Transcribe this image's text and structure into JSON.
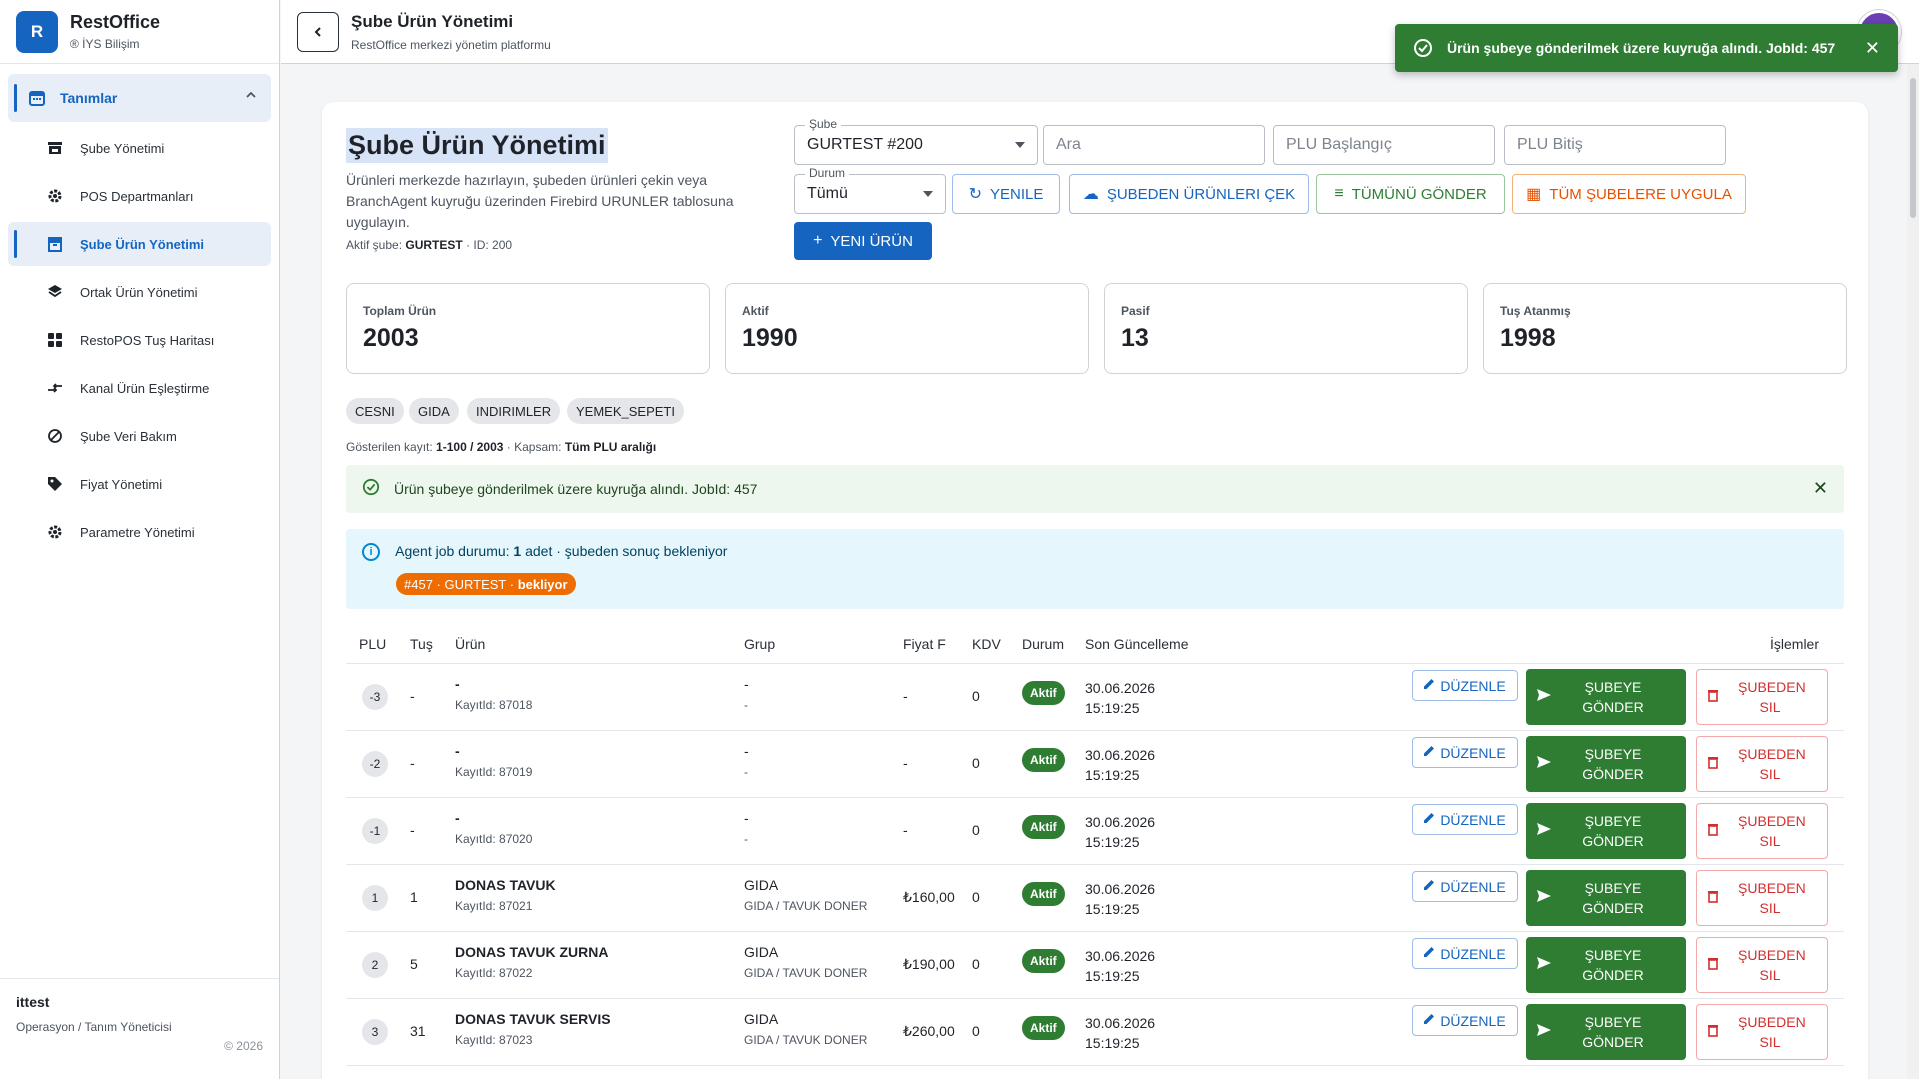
{
  "brand": {
    "logo_letter": "R",
    "title": "RestOffice",
    "subtitle": "® İYS Bilişim"
  },
  "sidebar": {
    "group_label": "Tanımlar",
    "items": [
      {
        "label": "Şube Yönetimi",
        "icon": "store-icon"
      },
      {
        "label": "POS Departmanları",
        "icon": "gear-icon"
      },
      {
        "label": "Şube Ürün Yönetimi",
        "icon": "inventory-icon",
        "active": true
      },
      {
        "label": "Ortak Ürün Yönetimi",
        "icon": "layers-icon"
      },
      {
        "label": "RestoPOS Tuş Haritası",
        "icon": "grid-icon"
      },
      {
        "label": "Kanal Ürün Eşleştirme",
        "icon": "compare-arrows-icon"
      },
      {
        "label": "Şube Veri Bakım",
        "icon": "block-icon"
      },
      {
        "label": "Fiyat Yönetimi",
        "icon": "tag-icon"
      },
      {
        "label": "Parametre Yönetimi",
        "icon": "gear-icon"
      }
    ],
    "user_name": "ittest",
    "user_role": "Operasyon / Tanım Yöneticisi",
    "copyright": "© 2026"
  },
  "topbar": {
    "title": "Şube Ürün Yönetimi",
    "subtitle": "RestOffice merkezi yönetim platformu"
  },
  "toast": {
    "message": "Ürün şubeye gönderilmek üzere kuyruğa alındı. JobId: 457",
    "color": "#2e7d32"
  },
  "page": {
    "title": "Şube Ürün Yönetimi",
    "description": "Ürünleri merkezde hazırlayın, şubeden ürünleri çekin veya BranchAgent kuyruğu üzerinden Firebird URUNLER tablosuna uygulayın.",
    "active_branch_prefix": "Aktif şube:",
    "active_branch": "GURTEST",
    "active_branch_id": "· ID: 200"
  },
  "filters": {
    "sube_label": "Şube",
    "sube_value": "GURTEST #200",
    "search_placeholder": "Ara",
    "plu_start_placeholder": "PLU Başlangıç",
    "plu_end_placeholder": "PLU Bitiş",
    "durum_label": "Durum",
    "durum_value": "Tümü"
  },
  "actions": {
    "refresh": "YENILE",
    "pull": "ŞUBEDEN ÜRÜNLERI ÇEK",
    "send_all": "TÜMÜNÜ GÖNDER",
    "apply_all": "TÜM ŞUBELERE UYGULA",
    "new_product": "YENI ÜRÜN"
  },
  "stats": [
    {
      "label": "Toplam Ürün",
      "value": "2003"
    },
    {
      "label": "Aktif",
      "value": "1990"
    },
    {
      "label": "Pasif",
      "value": "13"
    },
    {
      "label": "Tuş Atanmış",
      "value": "1998"
    }
  ],
  "chips": [
    "CESNI",
    "GIDA",
    "INDIRIMLER",
    "YEMEK_SEPETI"
  ],
  "shown": {
    "prefix": "Gösterilen kayıt:",
    "range": "1-100 / 2003",
    "scope_prefix": "· Kapsam:",
    "scope": "Tüm PLU aralığı"
  },
  "alert_success": {
    "message": "Ürün şubeye gönderilmek üzere kuyruğa alındı. JobId: 457"
  },
  "alert_info": {
    "prefix": "Agent job durumu:",
    "count": "1",
    "suffix": "adet · şubeden sonuç bekleniyor",
    "job_chip_text": "#457 · GURTEST ·",
    "job_chip_status": "bekliyor"
  },
  "table": {
    "headers": {
      "plu": "PLU",
      "tus": "Tuş",
      "urun": "Ürün",
      "grup": "Grup",
      "fiyat": "Fiyat F",
      "kdv": "KDV",
      "durum": "Durum",
      "son": "Son Güncelleme",
      "islemler": "İşlemler"
    },
    "edit_label": "DÜZENLE",
    "send_label": "ŞUBEYE GÖNDER",
    "delete_label": "ŞUBEDEN SIL",
    "rows": [
      {
        "plu": "-3",
        "tus": "-",
        "name": "-",
        "record": "KayıtId: 87018",
        "group": "-",
        "subgroup": "-",
        "price": "-",
        "kdv": "0",
        "status": "Aktif",
        "date": "30.06.2026",
        "time": "15:19:25"
      },
      {
        "plu": "-2",
        "tus": "-",
        "name": "-",
        "record": "KayıtId: 87019",
        "group": "-",
        "subgroup": "-",
        "price": "-",
        "kdv": "0",
        "status": "Aktif",
        "date": "30.06.2026",
        "time": "15:19:25"
      },
      {
        "plu": "-1",
        "tus": "-",
        "name": "-",
        "record": "KayıtId: 87020",
        "group": "-",
        "subgroup": "-",
        "price": "-",
        "kdv": "0",
        "status": "Aktif",
        "date": "30.06.2026",
        "time": "15:19:25"
      },
      {
        "plu": "1",
        "tus": "1",
        "name": "DONAS TAVUK",
        "record": "KayıtId: 87021",
        "group": "GIDA",
        "subgroup": "GIDA / TAVUK DONER",
        "price": "₺160,00",
        "kdv": "0",
        "status": "Aktif",
        "date": "30.06.2026",
        "time": "15:19:25"
      },
      {
        "plu": "2",
        "tus": "5",
        "name": "DONAS TAVUK ZURNA",
        "record": "KayıtId: 87022",
        "group": "GIDA",
        "subgroup": "GIDA / TAVUK DONER",
        "price": "₺190,00",
        "kdv": "0",
        "status": "Aktif",
        "date": "30.06.2026",
        "time": "15:19:25"
      },
      {
        "plu": "3",
        "tus": "31",
        "name": "DONAS TAVUK SERVIS",
        "record": "KayıtId: 87023",
        "group": "GIDA",
        "subgroup": "GIDA / TAVUK DONER",
        "price": "₺260,00",
        "kdv": "0",
        "status": "Aktif",
        "date": "30.06.2026",
        "time": "15:19:25"
      }
    ]
  }
}
